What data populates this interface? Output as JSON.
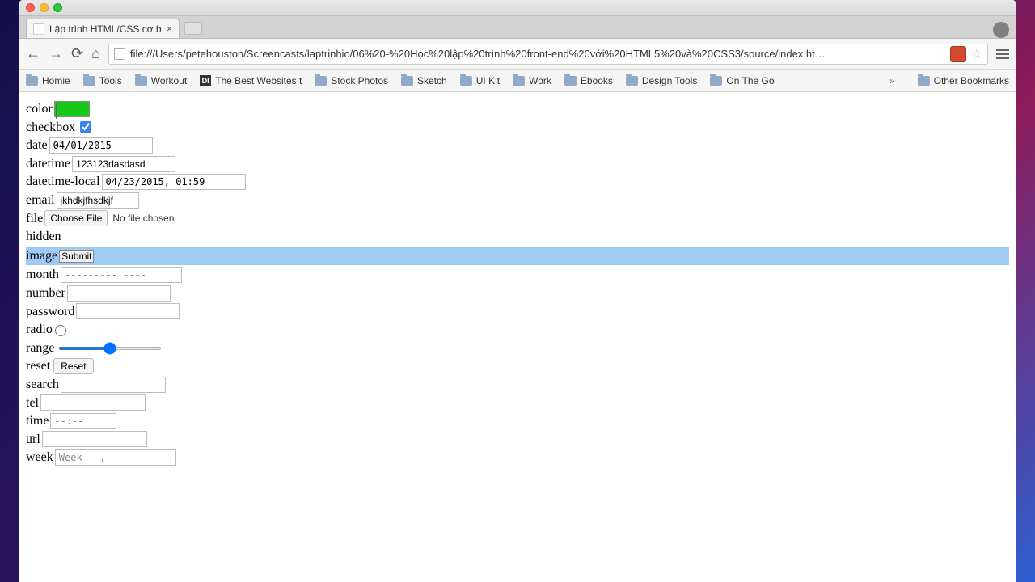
{
  "browser": {
    "tab_title": "Lập trình HTML/CSS cơ b",
    "url": "file:///Users/petehouston/Screencasts/laptrinhio/06%20-%20Học%20lập%20trình%20front-end%20với%20HTML5%20và%20CSS3/source/index.ht…",
    "bookmarks": [
      "Homie",
      "Tools",
      "Workout",
      "The Best Websites t",
      "Stock Photos",
      "Sketch",
      "UI Kit",
      "Work",
      "Ebooks",
      "Design Tools",
      "On The Go"
    ],
    "overflow": "»",
    "other_bookmarks": "Other Bookmarks"
  },
  "form": {
    "color_label": "color",
    "color_value": "#18c818",
    "checkbox_label": "checkbox",
    "checkbox_checked": true,
    "date_label": "date",
    "date_value": "04/01/2015",
    "datetime_label": "datetime",
    "datetime_value": "123123dasdasd",
    "datetime_local_label": "datetime-local",
    "datetime_local_value": "04/23/2015, 01:59",
    "email_label": "email",
    "email_value": "jkhdkjfhsdkjf",
    "file_label": "file",
    "file_button": "Choose File",
    "file_status": "No file chosen",
    "hidden_label": "hidden",
    "image_label": "image",
    "image_button": "Submit",
    "month_label": "month",
    "month_placeholder": "--------- ----",
    "number_label": "number",
    "password_label": "password",
    "radio_label": "radio",
    "range_label": "range",
    "reset_label": "reset",
    "reset_button": "Reset",
    "search_label": "search",
    "tel_label": "tel",
    "time_label": "time",
    "time_placeholder": "--:--",
    "url_label": "url",
    "week_label": "week",
    "week_placeholder": "Week --, ----"
  }
}
